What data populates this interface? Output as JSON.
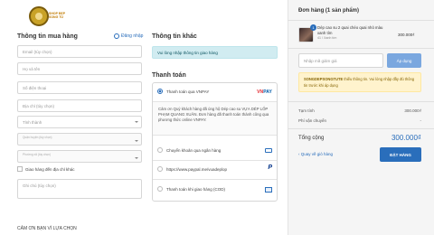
{
  "logo": {
    "tagline": "SHOP ĐẸP SONG TÚ"
  },
  "customer": {
    "title": "Thông tin mua hàng",
    "login_label": "Đăng nhập",
    "email_placeholder": "Email (tùy chọn)",
    "name_placeholder": "Họ và tên",
    "phone_placeholder": "Số điện thoại",
    "address_placeholder": "Địa chỉ (tùy chọn)",
    "province_placeholder": "Tỉnh thành",
    "district_label": "Quận huyện (tùy chọn)",
    "ward_label": "Phường xã (tùy chọn)",
    "ship_other_label": "Giao hàng đến địa chỉ khác",
    "note_placeholder": "Ghi chú (tùy chọn)",
    "thanks_text": "CẢM ƠN BẠN VÌ LỰA CHỌN"
  },
  "other_info": {
    "title": "Thông tin khác",
    "notice": "Vui lòng nhập thông tin giao hàng"
  },
  "payment": {
    "title": "Thanh toán",
    "selected": "vnpay",
    "methods": [
      {
        "id": "vnpay",
        "label": "Thanh toán qua VNPAY",
        "icon": "vnpay-logo"
      },
      {
        "id": "bank",
        "label": "Chuyển khoản qua ngân hàng",
        "icon": "bank-card-icon"
      },
      {
        "id": "paypal",
        "label": "https://www.paypal.me/vuadeplop",
        "icon": "paypal-icon"
      },
      {
        "id": "cod",
        "label": "Thanh toán khi giao hàng (COD)",
        "icon": "cash-icon"
      }
    ],
    "vnpay_desc": "Cảm ơn Quý khách hàng đã ủng hộ Dép cao su VỰA DÉP LỐP PHẠM QUANG XUÂN. Đơn hàng đã thanh toán thành công qua phương thức online VNPAY."
  },
  "order": {
    "title": "Đơn hàng (1 sản phẩm)",
    "item": {
      "quantity": "1",
      "name": "Dép cao su 2 quai chéo quai nhỏ màu xanh tím",
      "variant": "41 / Xanh tím",
      "price": "300.000₫"
    },
    "coupon_placeholder": "Nhập mã giảm giá",
    "coupon_button": "Áp dụng",
    "coupon_code": "SONGDEPSONGTUTE",
    "coupon_warning_after": " thiếu thông tin. Vui lòng nhập đầy đủ thông tin trước khi áp dụng",
    "subtotal_label": "Tạm tính",
    "subtotal_value": "300.000₫",
    "shipping_label": "Phí vận chuyển",
    "shipping_value": "-",
    "total_label": "Tổng cộng",
    "total_value": "300.000₫",
    "back_label": "Quay về giỏ hàng",
    "order_button": "ĐẶT HÀNG"
  },
  "colors": {
    "accent": "#2a6ebb",
    "info_bg": "#d1ecf1",
    "warn_bg": "#fff3cd"
  }
}
